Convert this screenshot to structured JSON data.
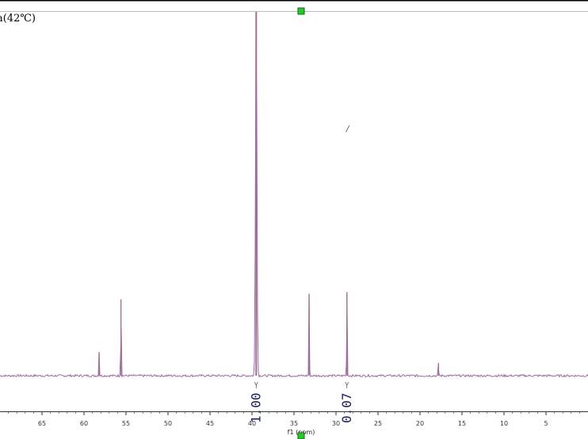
{
  "chart_data": {
    "type": "line",
    "title": "a(42℃)",
    "xlabel": "f1 (ppm)",
    "ylabel": "",
    "xlim": [
      70.0,
      0.0
    ],
    "x_reversed": true,
    "x_ticks": [
      65,
      60,
      55,
      50,
      45,
      40,
      35,
      30,
      25,
      20,
      15,
      10,
      5
    ],
    "x_tick_labels": [
      "65",
      "60",
      "55",
      "50",
      "45",
      "40",
      "35",
      "30",
      "25",
      "20",
      "15",
      "10",
      "5"
    ],
    "ylim": [
      0,
      1
    ],
    "baseline": 0.0,
    "grid": false,
    "legend": "none",
    "peaks": [
      {
        "ppm": 58.2,
        "height": 0.065
      },
      {
        "ppm": 55.6,
        "height": 0.21
      },
      {
        "ppm": 39.5,
        "height": 1.0
      },
      {
        "ppm": 33.2,
        "height": 0.225
      },
      {
        "ppm": 28.7,
        "height": 0.23
      },
      {
        "ppm": 17.8,
        "height": 0.035
      }
    ],
    "integrals": [
      {
        "ppm": 39.5,
        "label": "1.00"
      },
      {
        "ppm": 28.7,
        "label": "0.07"
      }
    ],
    "annotation": "/",
    "colors": {
      "spectrum": "#9e6d9e",
      "integral_text": "#1a1a6e",
      "cursor_marker": "#22cc22",
      "axis": "#333333",
      "frame": "#000000"
    }
  }
}
